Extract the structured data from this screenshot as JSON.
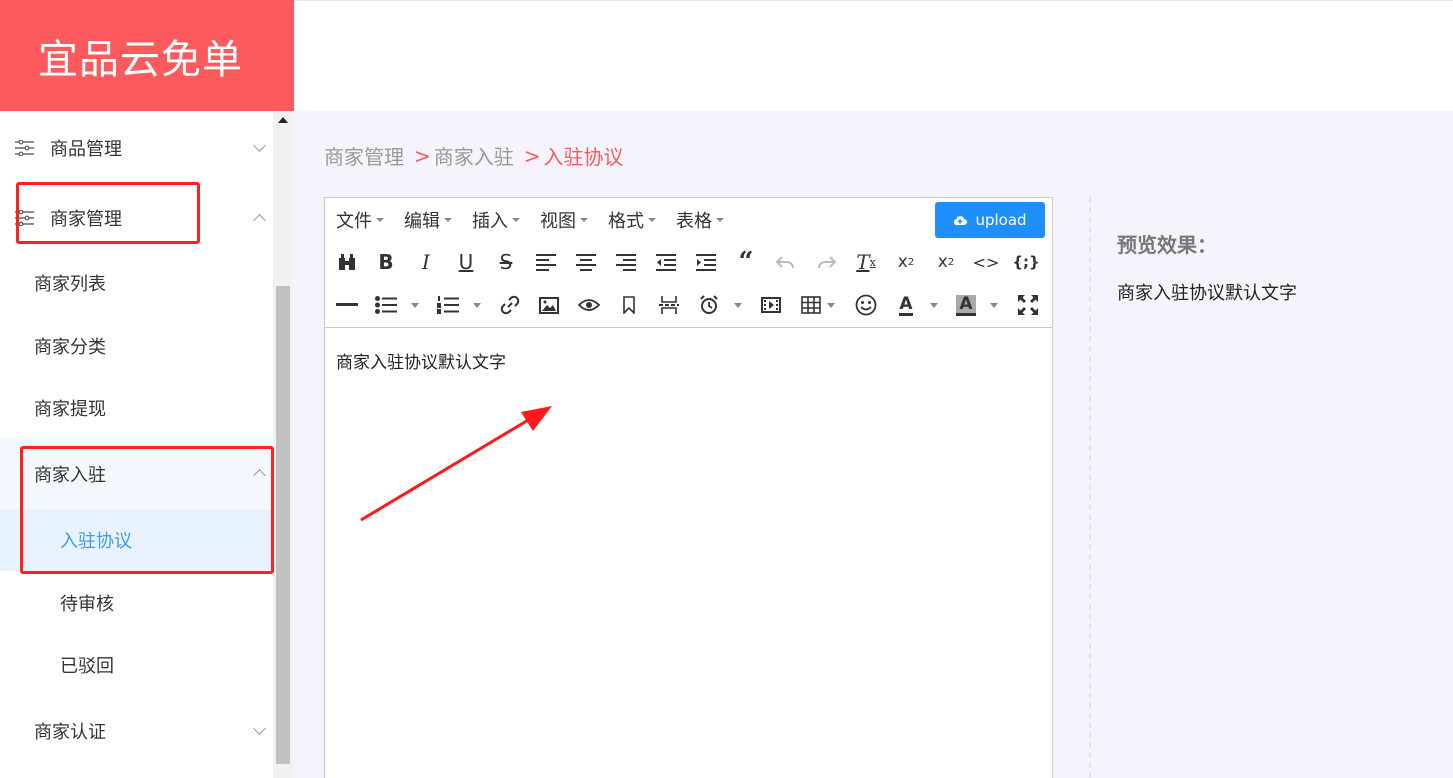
{
  "brand": {
    "title": "宜品云免单",
    "color": "#fd5a5d"
  },
  "sidebar": {
    "items": [
      {
        "label": "商品管理",
        "icon": "sliders-icon",
        "state": "collapsed"
      },
      {
        "label": "商家管理",
        "icon": "sliders-icon",
        "state": "expanded"
      },
      {
        "label": "商家列表"
      },
      {
        "label": "商家分类"
      },
      {
        "label": "商家提现"
      },
      {
        "label": "商家入驻",
        "state": "expanded"
      },
      {
        "label": "入驻协议",
        "active": true
      },
      {
        "label": "待审核"
      },
      {
        "label": "已驳回"
      },
      {
        "label": "商家认证",
        "state": "collapsed"
      }
    ],
    "active_color": "#3d9bf0"
  },
  "breadcrumb": {
    "items": [
      "商家管理",
      "商家入驻",
      "入驻协议"
    ],
    "separator": ">"
  },
  "editor": {
    "menus": [
      "文件",
      "编辑",
      "插入",
      "视图",
      "格式",
      "表格"
    ],
    "upload_label": "upload",
    "toolbar_icons_row1": [
      "find-replace-icon",
      "bold-icon",
      "italic-icon",
      "underline-icon",
      "strikethrough-icon",
      "align-left-icon",
      "align-center-icon",
      "align-right-icon",
      "outdent-icon",
      "indent-icon",
      "blockquote-icon",
      "undo-icon",
      "redo-icon",
      "clear-format-icon",
      "subscript-icon",
      "superscript-icon",
      "code-icon",
      "codesample-icon"
    ],
    "toolbar_icons_row2": [
      "hr-icon",
      "bullet-list-icon",
      "numbered-list-icon",
      "link-icon",
      "image-icon",
      "preview-icon",
      "bookmark-icon",
      "pagebreak-icon",
      "datetime-icon",
      "media-icon",
      "table-icon",
      "emoticon-icon",
      "text-color-icon",
      "background-color-icon",
      "fullscreen-icon"
    ],
    "content": "商家入驻协议默认文字"
  },
  "preview": {
    "title": "预览效果：",
    "text": "商家入驻协议默认文字"
  }
}
